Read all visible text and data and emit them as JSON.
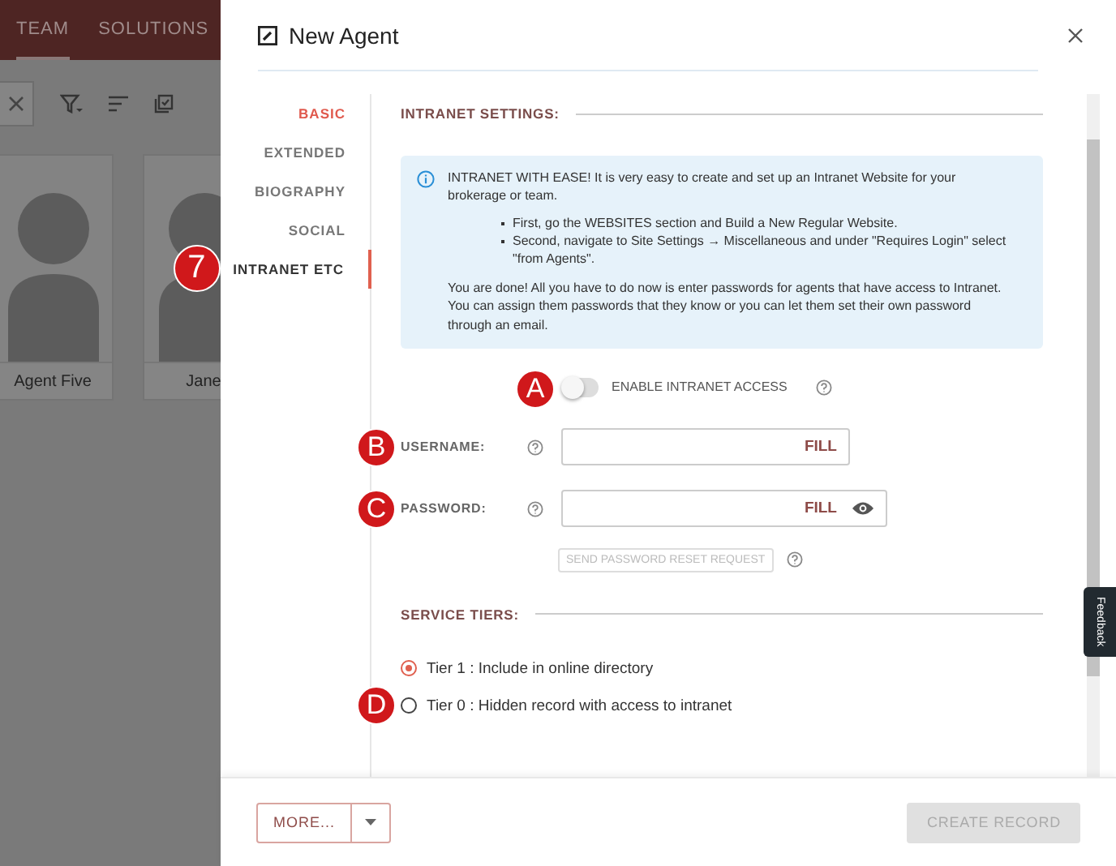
{
  "background": {
    "tabs": [
      {
        "label": "TEAM",
        "selected": true
      },
      {
        "label": "SOLUTIONS",
        "selected": false
      }
    ],
    "cards": [
      {
        "name": "Agent Five"
      },
      {
        "name": "Jane"
      }
    ]
  },
  "dialog": {
    "title": "New Agent"
  },
  "nav": [
    {
      "label": "BASIC",
      "selected": false,
      "error": true
    },
    {
      "label": "EXTENDED",
      "selected": false,
      "error": false
    },
    {
      "label": "BIOGRAPHY",
      "selected": false,
      "error": false
    },
    {
      "label": "SOCIAL",
      "selected": false,
      "error": false
    },
    {
      "label": "INTRANET ETC",
      "selected": true,
      "error": false,
      "marker": "7"
    }
  ],
  "intranet": {
    "title": "INTRANET SETTINGS:",
    "info": {
      "intro": "INTRANET WITH EASE! It is very easy to create and set up an Intranet Website for your brokerage or team.",
      "bullets": [
        "First, go the WEBSITES section and Build a New Regular Website.",
        "Second, navigate to Site Settings → Miscellaneous and under \"Requires Login\" select \"from Agents\"."
      ],
      "outro": "You are done! All you have to do now is enter passwords for agents that have access to Intranet. You can assign them passwords that they know or you can let them set their own password through an email."
    },
    "toggle": {
      "label": "ENABLE INTRANET ACCESS",
      "on": false,
      "marker": "A"
    },
    "fields": [
      {
        "kind": "text",
        "label": "USERNAME:",
        "action": "FILL",
        "marker": "B"
      },
      {
        "kind": "password",
        "label": "PASSWORD:",
        "action": "FILL",
        "marker": "C"
      }
    ],
    "reset_button": {
      "label": "SEND PASSWORD RESET REQUEST",
      "disabled": true
    }
  },
  "tiers": {
    "title": "SERVICE TIERS:",
    "marker": "D",
    "options": [
      {
        "label": "Tier 1 : Include in online directory",
        "selected": true
      },
      {
        "label": "Tier 0 : Hidden record with access to intranet",
        "selected": false
      }
    ]
  },
  "footer": {
    "more_button": "MORE...",
    "create_button": {
      "label": "CREATE RECORD",
      "disabled": true
    }
  },
  "feedback_tab": "Feedback"
}
